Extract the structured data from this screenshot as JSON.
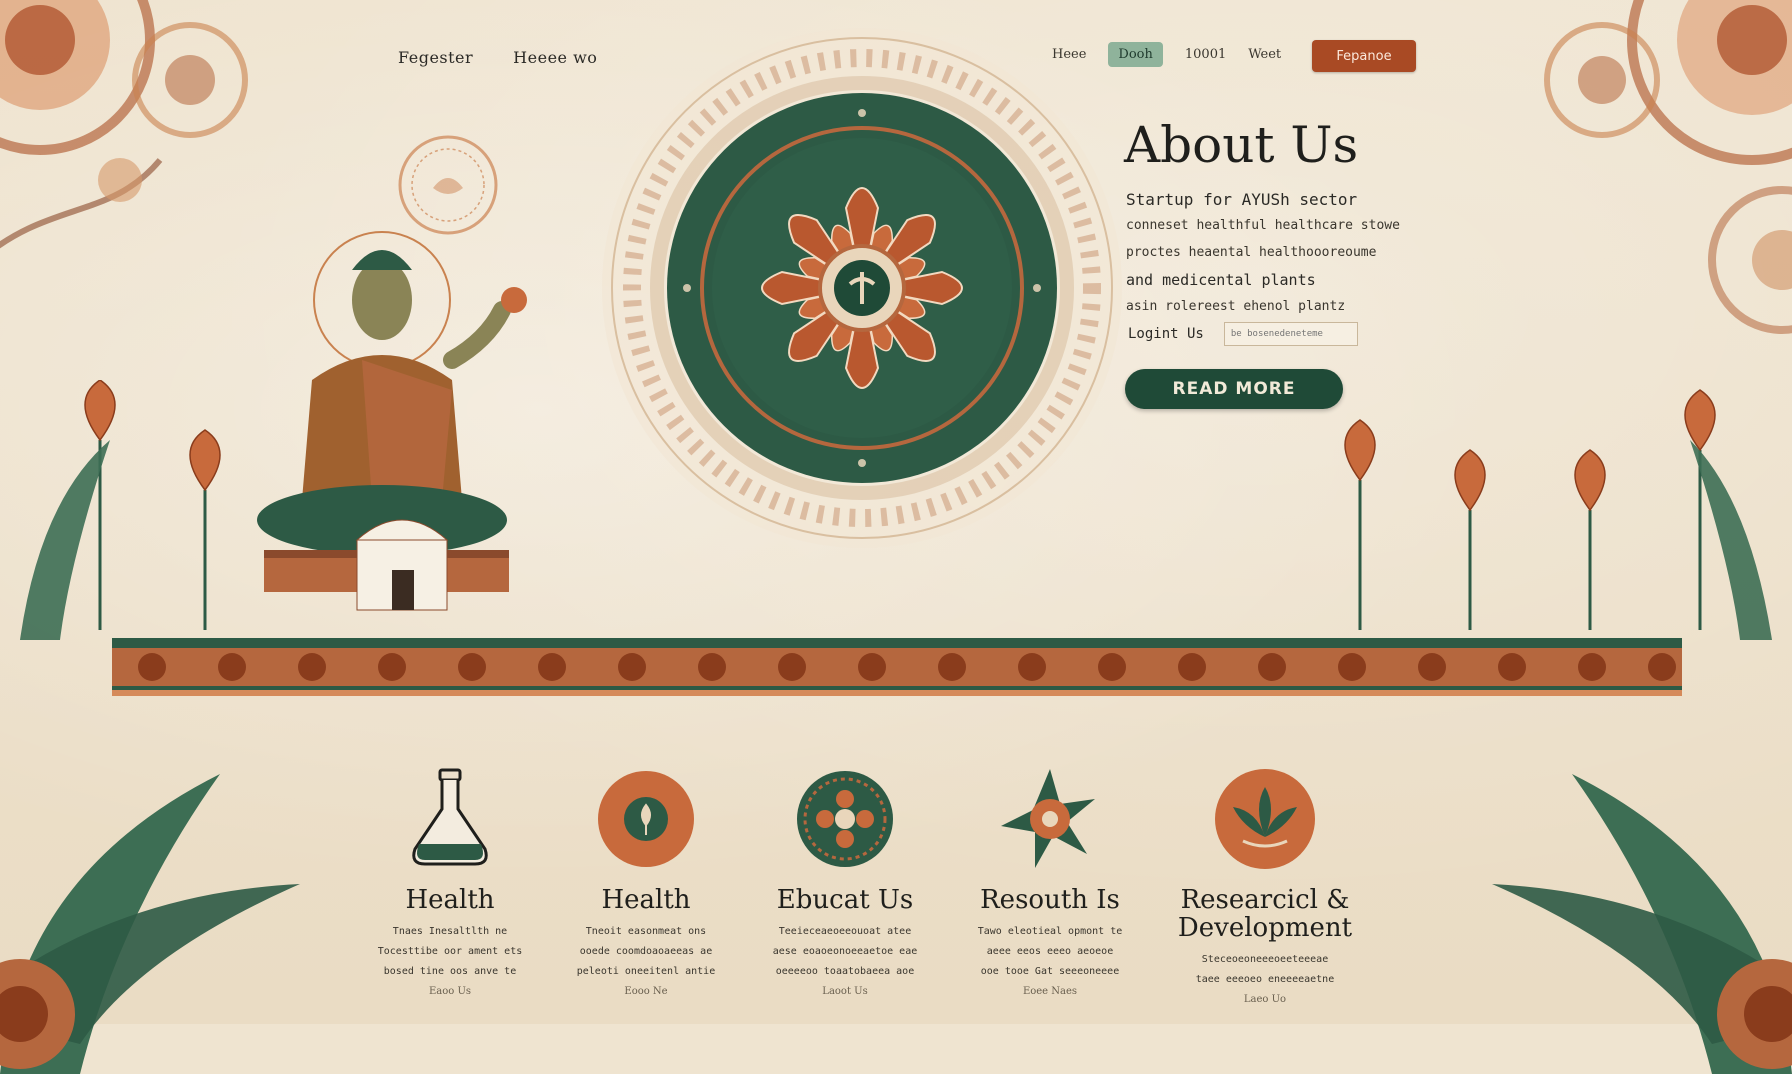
{
  "nav": {
    "left_links": [
      "Fegester",
      "Heeee wo"
    ],
    "right_links": [
      "Heee",
      "Dooh",
      "10001",
      "Weet"
    ],
    "highlighted_index": 1,
    "cta_label": "Fepanoe"
  },
  "hero": {
    "title": "About Us",
    "subtitle": "Startup for AYUSh sector",
    "description": [
      "conneset healthful healthcare stowe",
      "proctes heaental healthoooreoume",
      "and medicental plants",
      "asin rolereest ehenol plantz"
    ],
    "login_label": "Logint Us",
    "login_placeholder": "be bosenedeneteme",
    "read_more": "READ MORE"
  },
  "features": [
    {
      "icon": "flask-icon",
      "title": "Health",
      "lines": [
        "Tnaes Inesaltlth ne",
        "Tocesttibe oor ament ets",
        "bosed tine oos anve te"
      ],
      "more": "Eaoo Us"
    },
    {
      "icon": "seed-medallion-icon",
      "title": "Health",
      "lines": [
        "Tneoit easonmeat ons",
        "ooede coomdoaoaeeas ae",
        "peleoti oneeitenl antie"
      ],
      "more": "Eooo Ne"
    },
    {
      "icon": "mandala-medallion-icon",
      "title": "Ebucat Us",
      "lines": [
        "Teeieceaeoeeouoat atee",
        "aese eoaoeonoeeaetoe eae",
        "oeeeeoo toaatobaeea aoe"
      ],
      "more": "Laoot Us"
    },
    {
      "icon": "star-flower-icon",
      "title": "Resouth Is",
      "lines": [
        "Tawo eleotieal opmont te",
        "aeee eeos eeeo aeoeoe",
        "ooe tooe Gat seeeoneeee"
      ],
      "more": "Eoee Naes"
    },
    {
      "icon": "lotus-medallion-icon",
      "title": "Researcicl & Development",
      "lines": [
        "Steceoeoneeeoeeteeeae",
        "taee eeeoeo eneeeeaetne"
      ],
      "more": "Laeo Uo"
    }
  ],
  "colors": {
    "background": "#efe4d0",
    "primary_green": "#1f4a37",
    "accent_terracotta": "#a94a24",
    "highlight_green": "#8fb39b"
  }
}
